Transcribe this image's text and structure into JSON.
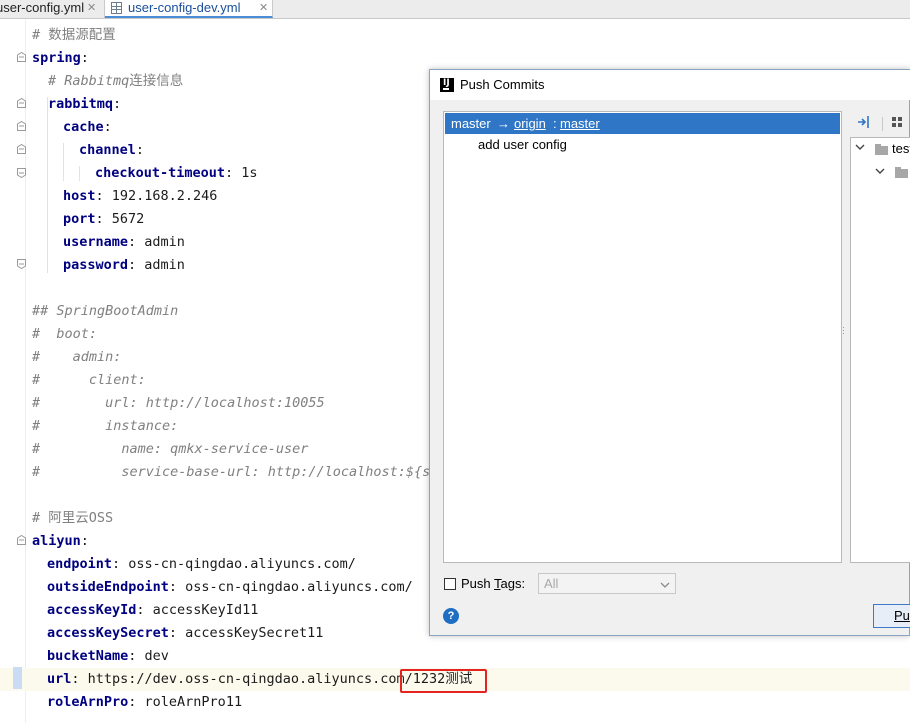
{
  "tabs": [
    {
      "label": "user-config.yml",
      "close": "✕"
    },
    {
      "label": "user-config-dev.yml",
      "close": "✕",
      "icon": "yaml-file-icon",
      "active": true
    }
  ],
  "editor": {
    "lines": [
      {
        "parts": [
          {
            "t": "# 数据源配置",
            "s": "cn"
          }
        ],
        "indent": 32
      },
      {
        "parts": [
          {
            "t": "spring",
            "s": "k"
          },
          {
            "t": ":",
            "s": "v"
          }
        ],
        "indent": 32
      },
      {
        "parts": [
          {
            "t": "# Rabbitmq",
            "s": "c"
          },
          {
            "t": "连接信息",
            "s": "cn"
          }
        ],
        "indent": 48
      },
      {
        "parts": [
          {
            "t": "rabbitmq",
            "s": "k"
          },
          {
            "t": ":",
            "s": "v"
          }
        ],
        "indent": 48
      },
      {
        "parts": [
          {
            "t": "cache",
            "s": "k"
          },
          {
            "t": ":",
            "s": "v"
          }
        ],
        "indent": 63
      },
      {
        "parts": [
          {
            "t": "channel",
            "s": "k"
          },
          {
            "t": ":",
            "s": "v"
          }
        ],
        "indent": 79
      },
      {
        "parts": [
          {
            "t": "checkout-timeout",
            "s": "k"
          },
          {
            "t": ": 1s",
            "s": "v"
          }
        ],
        "indent": 95
      },
      {
        "parts": [
          {
            "t": "host",
            "s": "k"
          },
          {
            "t": ": 192.168.2.246",
            "s": "v"
          }
        ],
        "indent": 63
      },
      {
        "parts": [
          {
            "t": "port",
            "s": "k"
          },
          {
            "t": ": 5672",
            "s": "v"
          }
        ],
        "indent": 63
      },
      {
        "parts": [
          {
            "t": "username",
            "s": "k"
          },
          {
            "t": ": admin",
            "s": "v"
          }
        ],
        "indent": 63
      },
      {
        "parts": [
          {
            "t": "password",
            "s": "k"
          },
          {
            "t": ": admin",
            "s": "v"
          }
        ],
        "indent": 63
      },
      {
        "parts": [],
        "indent": 32
      },
      {
        "parts": [
          {
            "t": "## SpringBootAdmin",
            "s": "c"
          }
        ],
        "indent": 32
      },
      {
        "parts": [
          {
            "t": "#  boot:",
            "s": "c"
          }
        ],
        "indent": 32
      },
      {
        "parts": [
          {
            "t": "#    admin:",
            "s": "c"
          }
        ],
        "indent": 32
      },
      {
        "parts": [
          {
            "t": "#      client:",
            "s": "c"
          }
        ],
        "indent": 32
      },
      {
        "parts": [
          {
            "t": "#        url: http://localhost:10055",
            "s": "c"
          }
        ],
        "indent": 32
      },
      {
        "parts": [
          {
            "t": "#        instance:",
            "s": "c"
          }
        ],
        "indent": 32
      },
      {
        "parts": [
          {
            "t": "#          name: qmkx-service-user",
            "s": "c"
          }
        ],
        "indent": 32
      },
      {
        "parts": [
          {
            "t": "#          service-base-url: http://localhost:${se",
            "s": "c"
          }
        ],
        "indent": 32
      },
      {
        "parts": [],
        "indent": 32
      },
      {
        "parts": [
          {
            "t": "# 阿里云OSS",
            "s": "cn"
          }
        ],
        "indent": 32
      },
      {
        "parts": [
          {
            "t": "aliyun",
            "s": "k"
          },
          {
            "t": ":",
            "s": "v"
          }
        ],
        "indent": 32
      },
      {
        "parts": [
          {
            "t": "endpoint",
            "s": "k"
          },
          {
            "t": ": oss-cn-qingdao.aliyuncs.com/",
            "s": "v"
          }
        ],
        "indent": 47
      },
      {
        "parts": [
          {
            "t": "outsideEndpoint",
            "s": "k"
          },
          {
            "t": ": oss-cn-qingdao.aliyuncs.com/",
            "s": "v"
          }
        ],
        "indent": 47
      },
      {
        "parts": [
          {
            "t": "accessKeyId",
            "s": "k"
          },
          {
            "t": ": accessKeyId11",
            "s": "v"
          }
        ],
        "indent": 47
      },
      {
        "parts": [
          {
            "t": "accessKeySecret",
            "s": "k"
          },
          {
            "t": ": accessKeySecret11",
            "s": "v"
          }
        ],
        "indent": 47
      },
      {
        "parts": [
          {
            "t": "bucketName",
            "s": "k"
          },
          {
            "t": ": dev",
            "s": "v"
          }
        ],
        "indent": 47
      },
      {
        "parts": [
          {
            "t": "url",
            "s": "k"
          },
          {
            "t": ": https://dev.oss-cn-qingdao.aliyuncs.com/1232测试",
            "s": "v"
          }
        ],
        "indent": 47,
        "caret": true
      },
      {
        "parts": [
          {
            "t": "roleArnPro",
            "s": "k"
          },
          {
            "t": ": roleArnPro11",
            "s": "v"
          }
        ],
        "indent": 47
      }
    ]
  },
  "dialog": {
    "title": "Push Commits",
    "branch_local": "master",
    "arrow": "→",
    "remote": "origin",
    "sep": ":",
    "branch_remote": "master",
    "commit_message": "add user config",
    "tree_root": "test",
    "push_tags_label_pre": "Push ",
    "push_tags_label_u": "T",
    "push_tags_label_post": "ags:",
    "tags_value": "All",
    "help": "?",
    "push_button": "Pu"
  }
}
